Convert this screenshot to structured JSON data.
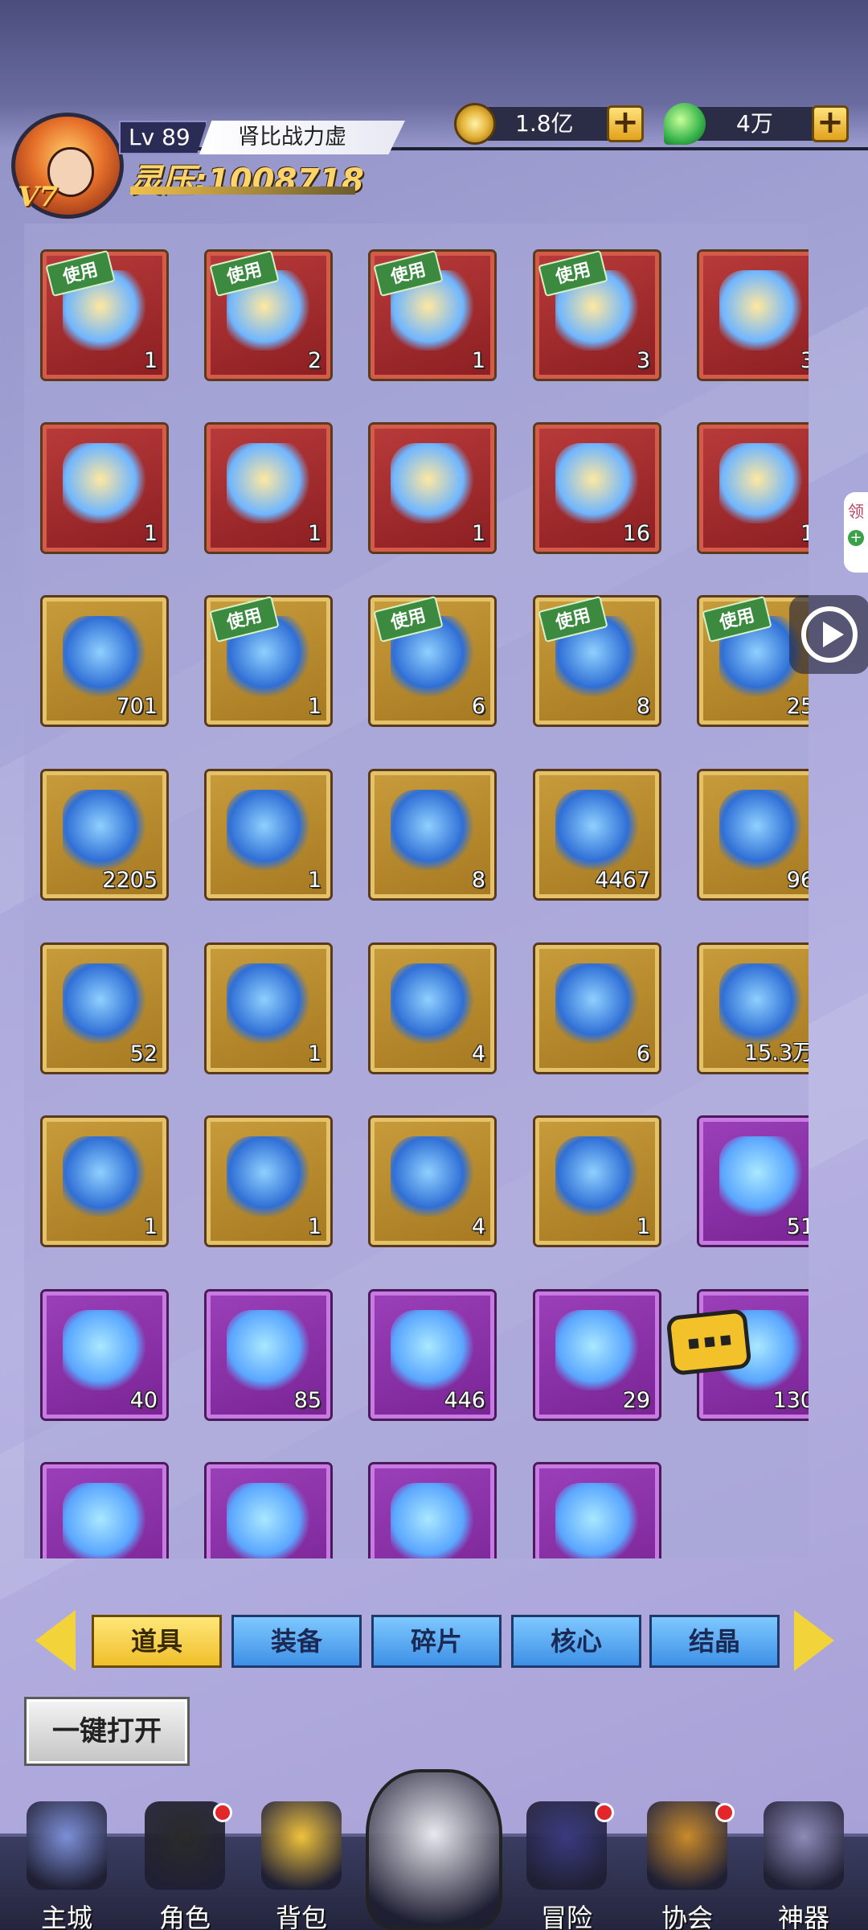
{
  "player": {
    "level": "Lv 89",
    "name": "肾比战力虚",
    "power": "灵压:1008718",
    "vip": "V7"
  },
  "currencies": [
    {
      "icon": "gold-coin-icon",
      "value": "1.8亿"
    },
    {
      "icon": "green-spirit-icon",
      "value": "4万"
    }
  ],
  "inventory": {
    "use_label": "使用",
    "items": [
      {
        "rarity": "red",
        "icon": "gift-box-icon",
        "count": "1",
        "use": true
      },
      {
        "rarity": "red",
        "icon": "open-box-icon",
        "count": "2",
        "use": true
      },
      {
        "rarity": "red",
        "icon": "open-box-icon",
        "count": "1",
        "use": true
      },
      {
        "rarity": "red",
        "icon": "puzzle-box-icon",
        "count": "3",
        "use": true
      },
      {
        "rarity": "red",
        "icon": "blue-crystal-icon",
        "count": "3",
        "use": false
      },
      {
        "rarity": "red",
        "icon": "flask-icon",
        "count": "1",
        "use": false
      },
      {
        "rarity": "red",
        "icon": "gem-icon",
        "count": "1",
        "use": false
      },
      {
        "rarity": "red",
        "icon": "blue-cube-icon",
        "count": "1",
        "use": false
      },
      {
        "rarity": "red",
        "icon": "orb-icon",
        "count": "16",
        "use": false
      },
      {
        "rarity": "red",
        "icon": "dragon-icon",
        "count": "1",
        "use": false
      },
      {
        "rarity": "gold",
        "icon": "cards-icon",
        "count": "701",
        "use": false
      },
      {
        "rarity": "gold",
        "icon": "gift-box-icon",
        "count": "1",
        "use": true
      },
      {
        "rarity": "gold",
        "icon": "gift-box-icon",
        "count": "6",
        "use": true
      },
      {
        "rarity": "gold",
        "icon": "mystery-box-icon",
        "count": "8",
        "use": true
      },
      {
        "rarity": "gold",
        "icon": "puzzle-box-icon",
        "count": "25",
        "use": true
      },
      {
        "rarity": "gold",
        "icon": "ore-icon",
        "count": "2205",
        "use": false
      },
      {
        "rarity": "gold",
        "icon": "orange-cube-icon",
        "count": "1",
        "use": false
      },
      {
        "rarity": "gold",
        "icon": "ring-icon",
        "count": "8",
        "use": false
      },
      {
        "rarity": "gold",
        "icon": "energy-orb-icon",
        "count": "4467",
        "use": false
      },
      {
        "rarity": "gold",
        "icon": "potion-icon",
        "count": "96",
        "use": false
      },
      {
        "rarity": "gold",
        "icon": "spirit-flame-icon",
        "count": "52",
        "use": false
      },
      {
        "rarity": "gold",
        "icon": "rainbow-ticket-icon",
        "count": "1",
        "use": false
      },
      {
        "rarity": "gold",
        "icon": "gold-ticket-icon",
        "count": "4",
        "use": false
      },
      {
        "rarity": "gold",
        "icon": "crystal-cluster-icon",
        "count": "6",
        "use": false
      },
      {
        "rarity": "gold",
        "icon": "blue-sphere-icon",
        "count": "15.3万",
        "use": false
      },
      {
        "rarity": "gold",
        "icon": "hex-emblem-icon",
        "count": "1",
        "use": false
      },
      {
        "rarity": "gold",
        "icon": "hex-emblem-icon",
        "count": "1",
        "use": false
      },
      {
        "rarity": "gold",
        "icon": "hex-emblem-icon",
        "count": "4",
        "use": false
      },
      {
        "rarity": "gold",
        "icon": "hex-emblem-icon",
        "count": "1",
        "use": false
      },
      {
        "rarity": "purple",
        "icon": "rocket-icon",
        "count": "51",
        "use": false
      },
      {
        "rarity": "purple",
        "icon": "cubes-icon",
        "count": "40",
        "use": false
      },
      {
        "rarity": "purple",
        "icon": "ticket-icon",
        "count": "85",
        "use": false
      },
      {
        "rarity": "purple",
        "icon": "dna-icon",
        "count": "446",
        "use": false
      },
      {
        "rarity": "purple",
        "icon": "dna-icon",
        "count": "29",
        "use": false
      },
      {
        "rarity": "purple",
        "icon": "dna-icon",
        "count": "130",
        "use": false
      },
      {
        "rarity": "purple",
        "icon": "dna-icon",
        "count": "",
        "use": false
      },
      {
        "rarity": "purple",
        "icon": "dna-icon",
        "count": "",
        "use": false
      },
      {
        "rarity": "purple",
        "icon": "silver-ticket-icon",
        "count": "",
        "use": false
      },
      {
        "rarity": "purple",
        "icon": "lottery-ticket-icon",
        "count": "",
        "use": false
      }
    ]
  },
  "side_chip": "领",
  "tabs": [
    {
      "label": "道具",
      "active": true
    },
    {
      "label": "装备",
      "active": false
    },
    {
      "label": "碎片",
      "active": false
    },
    {
      "label": "核心",
      "active": false
    },
    {
      "label": "结晶",
      "active": false
    }
  ],
  "open_all_label": "一键打开",
  "nav": [
    {
      "label": "主城",
      "icon": "city-icon",
      "dot": false
    },
    {
      "label": "角色",
      "icon": "character-icon",
      "dot": true
    },
    {
      "label": "背包",
      "icon": "backpack-icon",
      "dot": false
    },
    {
      "label": "",
      "icon": "mask-hero-icon",
      "dot": false
    },
    {
      "label": "冒险",
      "icon": "eye-icon",
      "dot": true
    },
    {
      "label": "协会",
      "icon": "guild-icon",
      "dot": true
    },
    {
      "label": "神器",
      "icon": "artifact-icon",
      "dot": false
    }
  ]
}
